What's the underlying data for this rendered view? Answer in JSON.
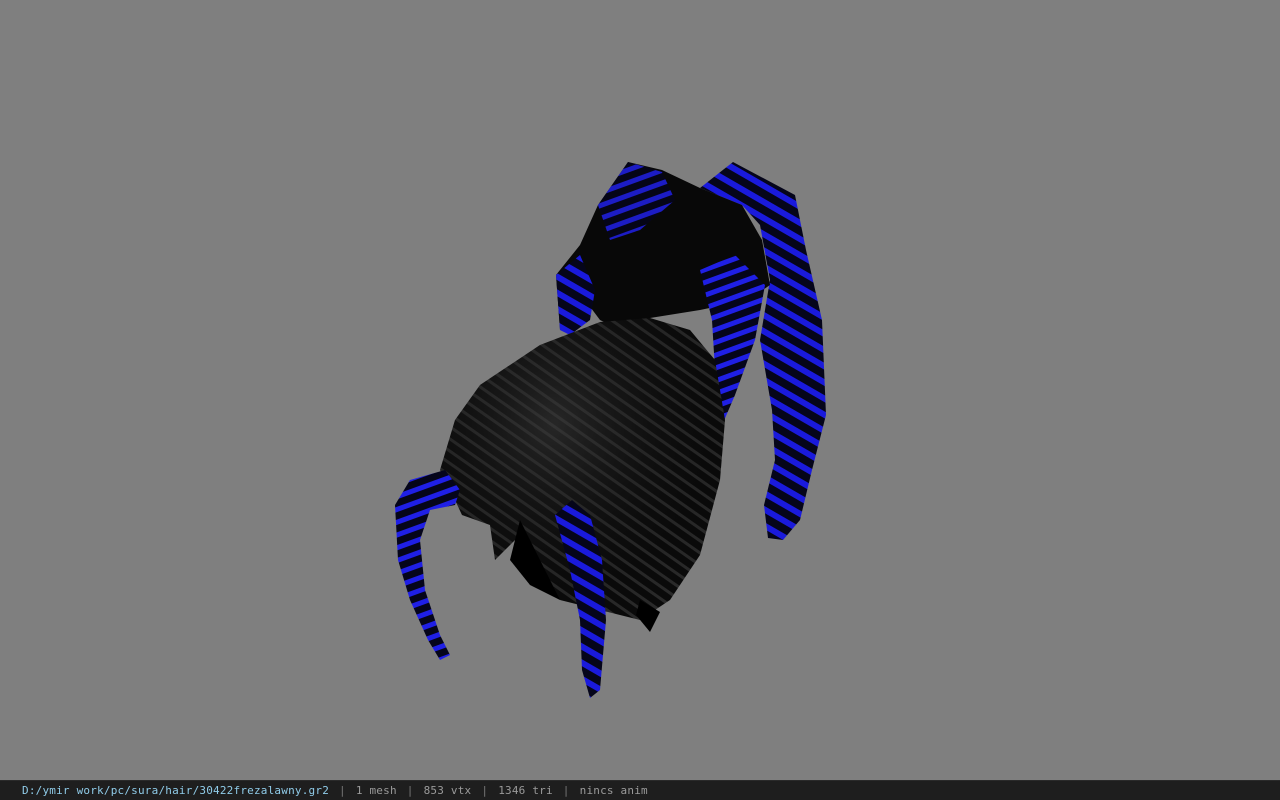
{
  "viewport": {
    "background_color": "#7f7f7f",
    "model": {
      "icon": "spider-model",
      "body_color": "#0b0b0b",
      "stripe_color": "#1a1adc"
    }
  },
  "statusbar": {
    "file_path": "D:/ymir work/pc/sura/hair/30422frezalawny.gr2",
    "separator": "|",
    "mesh_count": "1 mesh",
    "vertex_count": "853 vtx",
    "triangle_count": "1346 tri",
    "anim_status": "nincs anim"
  }
}
